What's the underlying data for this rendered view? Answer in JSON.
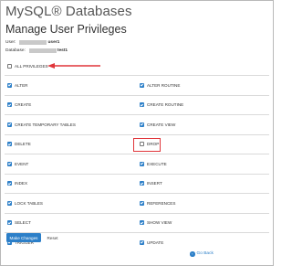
{
  "app_title": "MySQL® Databases",
  "page_title": "Manage User Privileges",
  "user": {
    "label": "User:",
    "value_suffix": "user1"
  },
  "database": {
    "label": "Database:",
    "value_suffix": "test1"
  },
  "all_privileges": {
    "label": "ALL PRIVILEGES",
    "checked": false
  },
  "privileges": [
    {
      "label": "ALTER",
      "checked": true
    },
    {
      "label": "ALTER ROUTINE",
      "checked": true
    },
    {
      "label": "CREATE",
      "checked": true
    },
    {
      "label": "CREATE ROUTINE",
      "checked": true
    },
    {
      "label": "CREATE TEMPORARY TABLES",
      "checked": true
    },
    {
      "label": "CREATE VIEW",
      "checked": true
    },
    {
      "label": "DELETE",
      "checked": true
    },
    {
      "label": "DROP",
      "checked": false
    },
    {
      "label": "EVENT",
      "checked": true
    },
    {
      "label": "EXECUTE",
      "checked": true
    },
    {
      "label": "INDEX",
      "checked": true
    },
    {
      "label": "INSERT",
      "checked": true
    },
    {
      "label": "LOCK TABLES",
      "checked": true
    },
    {
      "label": "REFERENCES",
      "checked": true
    },
    {
      "label": "SELECT",
      "checked": true
    },
    {
      "label": "SHOW VIEW",
      "checked": true
    },
    {
      "label": "TRIGGER",
      "checked": true
    },
    {
      "label": "UPDATE",
      "checked": true
    }
  ],
  "buttons": {
    "save": "Make Changes",
    "reset": "Reset"
  },
  "go_back": {
    "label": "Go Back",
    "icon": "arrow-left-circle-icon"
  },
  "colors": {
    "accent": "#2c7fc8",
    "annotation": "#e0353a"
  }
}
